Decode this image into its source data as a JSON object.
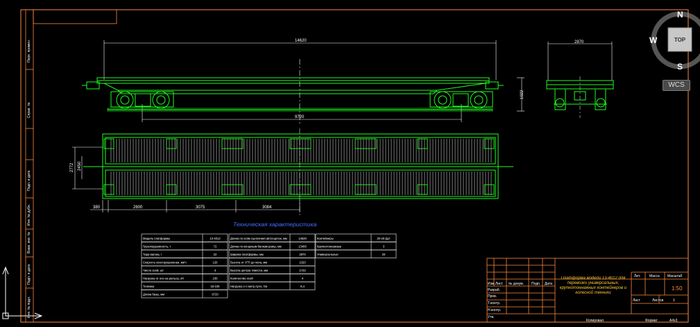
{
  "viewcube": {
    "north": "N",
    "south": "S",
    "west": "W",
    "top": "TOP",
    "wcs": "WCS"
  },
  "title_block": {
    "title": "Платформа модели 13-4012 для перевозки универсальных, крупнотоннажных контейнеров и колесной техники",
    "sheet_scale": "1:50",
    "sheet_num": "1",
    "sheet_label_lit": "Лит.",
    "sheet_label_mass": "Масса",
    "sheet_label_scale": "Масштаб",
    "sheet_label_list": "Лист",
    "sheet_label_lists": "Листов",
    "copied": "Копировал",
    "format": "Формат",
    "format_val": "A4x3",
    "rows": [
      "Изм.",
      "Лист",
      "№ докум.",
      "Подп.",
      "Дата",
      "Разраб.",
      "Пров.",
      "Т.контр.",
      "Н.контр.",
      "Утв."
    ]
  },
  "dims": {
    "top_len": "14620",
    "bogie_base": "9720",
    "height": "1022",
    "end_w": "2870",
    "plan_w": "2772",
    "plan_inner": "2450",
    "seg1": "2600",
    "seg2": "3075",
    "seg3": "3084",
    "left_small": "380"
  },
  "tech_title": "Техническая характеристика",
  "tables": [
    {
      "rows": [
        [
          "Модель платформы",
          "13-4012"
        ],
        [
          "Грузоподъемность, т",
          "72"
        ],
        [
          "Тара вагона, т",
          "22"
        ],
        [
          "Скорость конструкционная, км/ч",
          "120"
        ],
        [
          "Число осей, шт",
          "4"
        ],
        [
          "Нагрузка от оси на рельсы, кН",
          "230"
        ],
        [
          "Тележка",
          "18-100"
        ],
        [
          "Длина базы, мм",
          "9720"
        ]
      ]
    },
    {
      "rows": [
        [
          "Длина по осям сцепления автосцепок, мм",
          "14620"
        ],
        [
          "Длина по концевым балкам рамы, мм",
          "13400"
        ],
        [
          "Ширина платформы, мм",
          "2870"
        ],
        [
          "Высота от УГР до пола, мм",
          "1320"
        ],
        [
          "Высота центра тяжести, мм",
          "1722"
        ],
        [
          "Количество осей",
          "4"
        ],
        [
          "Нагрузка 1-п метр пути, т/м",
          "6,4"
        ]
      ]
    },
    {
      "rows": [
        [
          "Контейнеры",
          "20-40 фут"
        ],
        [
          "Крупнотоннажные",
          "3"
        ],
        [
          "Универсальные",
          "20"
        ]
      ]
    }
  ]
}
